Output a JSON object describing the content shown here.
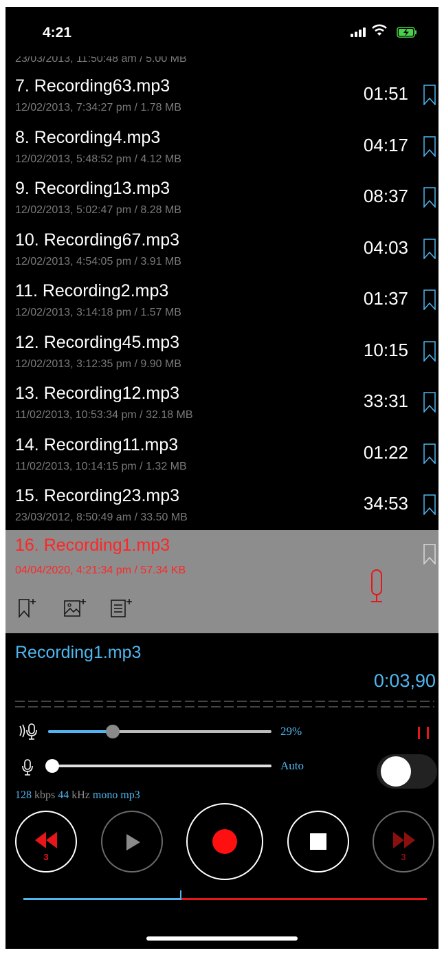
{
  "status": {
    "time": "4:21"
  },
  "partial_row_meta": "23/03/2013, 11:50:48 am / 5.00 MB",
  "recordings": [
    {
      "title": "7. Recording63.mp3",
      "meta": "12/02/2013, 7:34:27 pm / 1.78 MB",
      "duration": "01:51"
    },
    {
      "title": "8. Recording4.mp3",
      "meta": "12/02/2013, 5:48:52 pm / 4.12 MB",
      "duration": "04:17"
    },
    {
      "title": "9. Recording13.mp3",
      "meta": "12/02/2013, 5:02:47 pm / 8.28 MB",
      "duration": "08:37"
    },
    {
      "title": "10. Recording67.mp3",
      "meta": "12/02/2013, 4:54:05 pm / 3.91 MB",
      "duration": "04:03"
    },
    {
      "title": "11. Recording2.mp3",
      "meta": "12/02/2013, 3:14:18 pm / 1.57 MB",
      "duration": "01:37"
    },
    {
      "title": "12. Recording45.mp3",
      "meta": "12/02/2013, 3:12:35 pm / 9.90 MB",
      "duration": "10:15"
    },
    {
      "title": "13. Recording12.mp3",
      "meta": "11/02/2013, 10:53:34 pm / 32.18 MB",
      "duration": "33:31"
    },
    {
      "title": "14. Recording11.mp3",
      "meta": "11/02/2013, 10:14:15 pm / 1.32 MB",
      "duration": "01:22"
    },
    {
      "title": "15. Recording23.mp3",
      "meta": "23/03/2012, 8:50:49 am / 33.50 MB",
      "duration": "34:53"
    }
  ],
  "selected": {
    "title": "16. Recording1.mp3",
    "meta": "04/04/2020, 4:21:34 pm / 57.34 KB"
  },
  "player": {
    "file_name": "Recording1.mp3",
    "elapsed": "0:03,90",
    "input_gain_label": "29%",
    "input_gain_fraction": 0.29,
    "mic_level_label": "Auto",
    "mic_level_fraction": 0.0,
    "auto_toggle_on": false,
    "bitrate": "128",
    "bitrate_unit": "kbps",
    "sample_rate": "44",
    "sample_rate_unit": "kHz",
    "channels": "mono",
    "codec": "mp3",
    "rewind_seconds": "3",
    "forward_seconds": "3",
    "position_fraction": 0.39
  },
  "colors": {
    "accent_blue": "#4fb6ef",
    "record_red": "#e8161a",
    "selected_bg": "#8d8d8d",
    "background": "#000000"
  },
  "icons": {
    "bookmark": "bookmark-outline-icon",
    "add_bookmark": "add-bookmark-icon",
    "add_image": "add-image-icon",
    "add_note": "add-note-icon",
    "mic": "microphone-icon"
  }
}
